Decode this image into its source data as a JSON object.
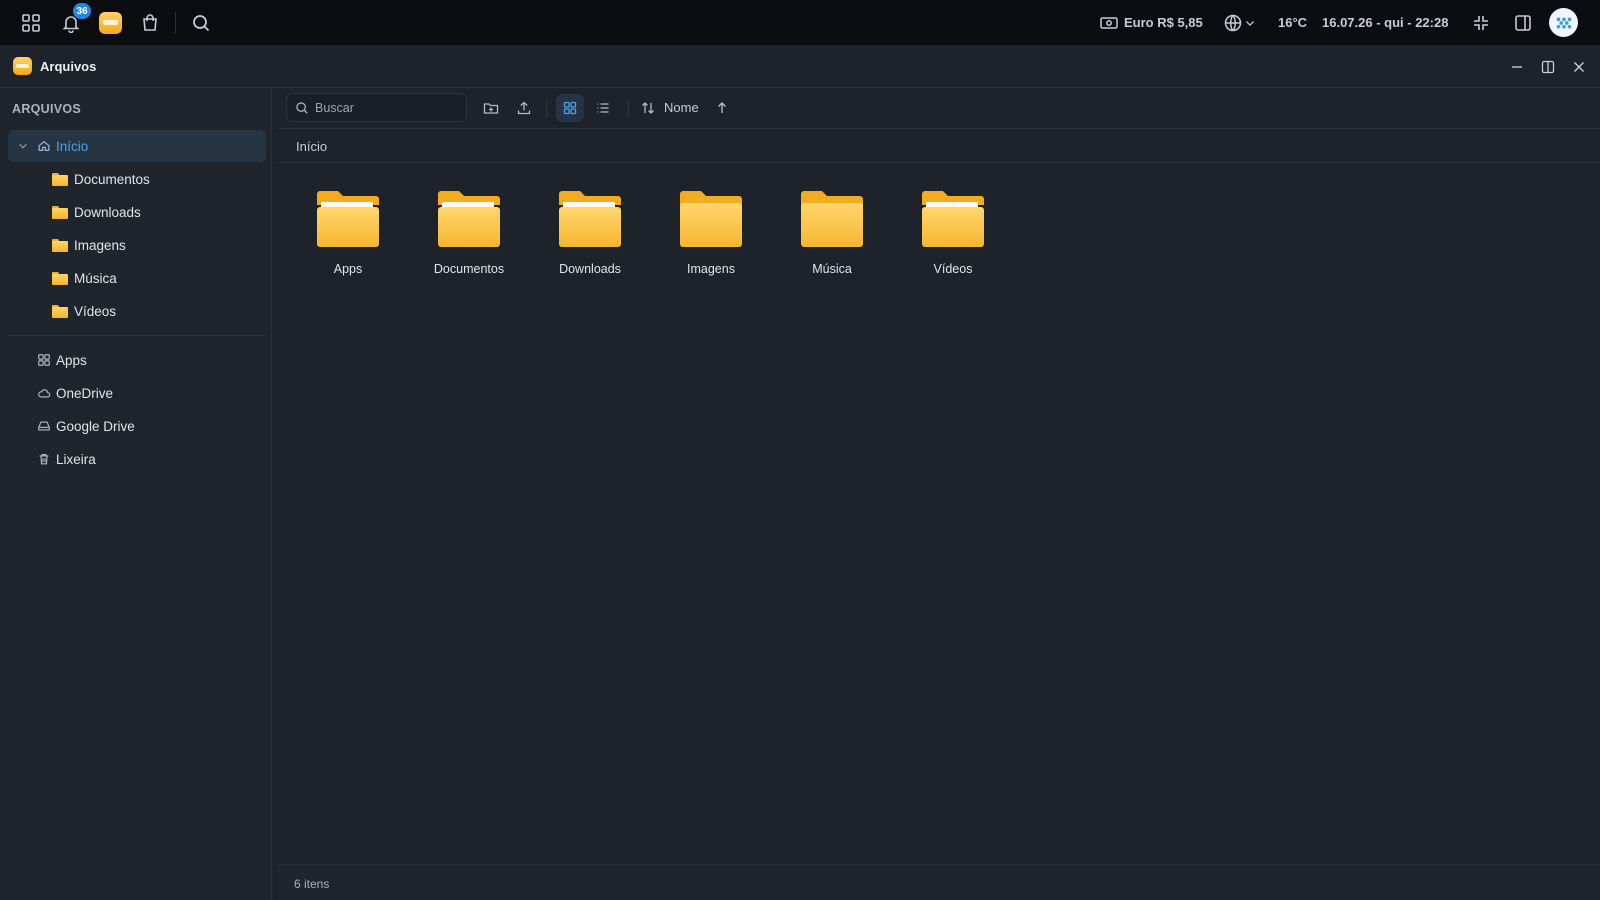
{
  "topbar": {
    "notification_count": "36",
    "currency": "Euro R$ 5,85",
    "temperature": "16°C",
    "datetime": "16.07.26 - qui - 22:28"
  },
  "window": {
    "title": "Arquivos"
  },
  "sidebar": {
    "heading": "ARQUIVOS",
    "home": "Início",
    "children": [
      "Documentos",
      "Downloads",
      "Imagens",
      "Música",
      "Vídeos"
    ],
    "places": [
      {
        "label": "Apps",
        "icon": "apps-icon"
      },
      {
        "label": "OneDrive",
        "icon": "cloud-icon"
      },
      {
        "label": "Google Drive",
        "icon": "drive-icon"
      },
      {
        "label": "Lixeira",
        "icon": "trash-icon"
      }
    ]
  },
  "toolbar": {
    "search_placeholder": "Buscar",
    "sort_label": "Nome"
  },
  "path": {
    "current": "Início"
  },
  "folders": [
    {
      "label": "Apps",
      "has_content": true
    },
    {
      "label": "Documentos",
      "has_content": true
    },
    {
      "label": "Downloads",
      "has_content": true
    },
    {
      "label": "Imagens",
      "has_content": false
    },
    {
      "label": "Música",
      "has_content": false
    },
    {
      "label": "Vídeos",
      "has_content": true
    }
  ],
  "status": {
    "count": "6 itens"
  },
  "colors": {
    "accent": "#4aa3ee",
    "folder": "#f5b52b",
    "background": "#1d222b"
  }
}
